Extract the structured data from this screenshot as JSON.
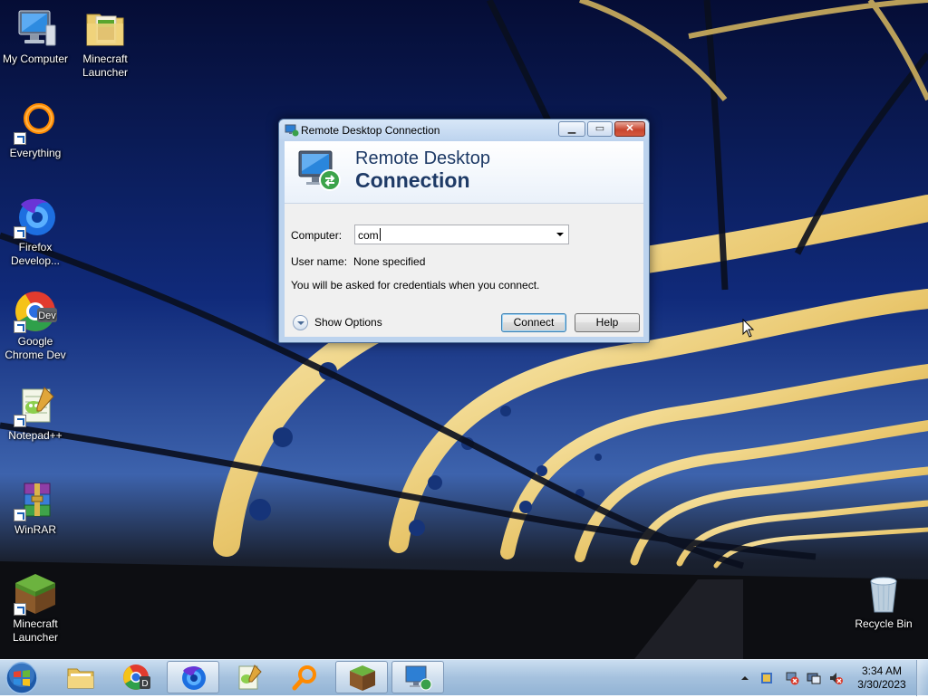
{
  "desktop": {
    "icons": [
      {
        "label": "My Computer",
        "icon": "computer-icon",
        "shortcut": false
      },
      {
        "label": "Minecraft Launcher",
        "icon": "minecraft-folder-icon",
        "shortcut": false
      },
      {
        "label": "Everything",
        "icon": "everything-search-icon",
        "shortcut": true
      },
      {
        "label": "Firefox Develop...",
        "icon": "firefox-developer-icon",
        "shortcut": true
      },
      {
        "label": "Google Chrome Dev",
        "icon": "chrome-dev-icon",
        "shortcut": true
      },
      {
        "label": "Notepad++",
        "icon": "notepadpp-icon",
        "shortcut": true
      },
      {
        "label": "WinRAR",
        "icon": "winrar-icon",
        "shortcut": true
      },
      {
        "label": "Minecraft Launcher",
        "icon": "minecraft-grass-block-icon",
        "shortcut": true
      },
      {
        "label": "Recycle Bin",
        "icon": "recycle-bin-icon",
        "shortcut": false
      }
    ]
  },
  "dialog": {
    "title": "Remote Desktop Connection",
    "banner_line1": "Remote Desktop",
    "banner_line2": "Connection",
    "computer_label": "Computer:",
    "computer_value": "com",
    "username_label": "User name:",
    "username_value": "None specified",
    "credentials_note": "You will be asked for credentials when you connect.",
    "show_options": "Show Options",
    "connect_label": "Connect",
    "help_label": "Help"
  },
  "taskbar": {
    "pinned": [
      {
        "name": "explorer-icon",
        "active": false
      },
      {
        "name": "chrome-dev-icon",
        "active": false
      },
      {
        "name": "firefox-developer-icon",
        "active": true
      },
      {
        "name": "notepadpp-icon",
        "active": false
      },
      {
        "name": "everything-search-icon",
        "active": false
      },
      {
        "name": "minecraft-grass-block-icon",
        "active": true
      },
      {
        "name": "remote-desktop-icon",
        "active": true
      }
    ],
    "tray_icons": [
      "show-hidden-icons-arrow",
      "action-center-icon",
      "network-disconnected-icon",
      "display-icon",
      "volume-muted-icon"
    ],
    "time": "3:34 AM",
    "date": "3/30/2023"
  },
  "colors": {
    "accent": "#1e3a66",
    "close_button": "#c8452e",
    "dialog_frame": "#bcd3ee"
  }
}
